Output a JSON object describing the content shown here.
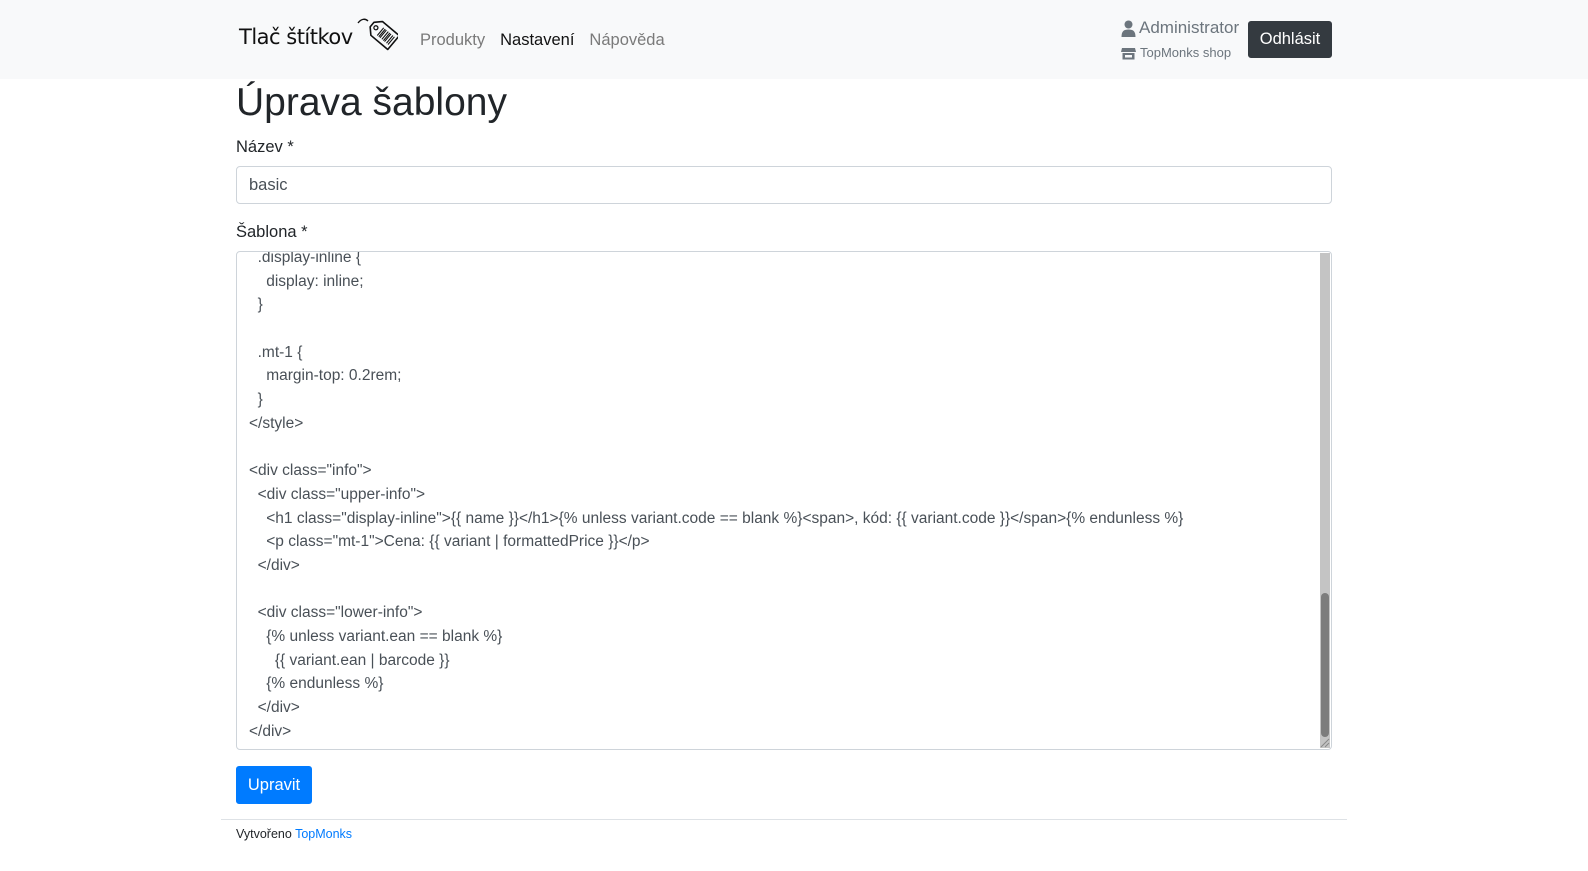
{
  "navbar": {
    "brand": "Tlač štítkov",
    "brand_icon": "price-tag-barcode-icon",
    "links": [
      {
        "label": "Produkty",
        "active": false
      },
      {
        "label": "Nastavení",
        "active": true
      },
      {
        "label": "Nápověda",
        "active": false
      }
    ],
    "user_name": "Administrator",
    "user_icon": "user-icon",
    "shop_name": "TopMonks shop",
    "shop_icon": "store-icon",
    "logout_label": "Odhlásit",
    "background": "#f8f9fa",
    "logout_color": "#343a40"
  },
  "page": {
    "title": "Úprava šablony",
    "name_label": "Název *",
    "name_value": "basic",
    "template_label": "Šablona *",
    "template_lines": [
      "  .display-inline {",
      "    display: inline;",
      "  }",
      "",
      "  .mt-1 {",
      "    margin-top: 0.2rem;",
      "  }",
      "</style>",
      "",
      "<div class=\"info\">",
      "  <div class=\"upper-info\">",
      "    <h1 class=\"display-inline\">{{ name }}</h1>{% unless variant.code == blank %}<span>, kód: {{ variant.code }}</span>{% endunless %}",
      "    <p class=\"mt-1\">Cena: {{ variant | formattedPrice }}</p>",
      "  </div>",
      "",
      "  <div class=\"lower-info\">",
      "    {% unless variant.ean == blank %}",
      "      {{ variant.ean | barcode }}",
      "    {% endunless %}",
      "  </div>",
      "</div>"
    ],
    "submit_label": "Upravit",
    "submit_color": "#007bff"
  },
  "footer": {
    "prefix": "Vytvořeno",
    "link_label": "TopMonks"
  }
}
